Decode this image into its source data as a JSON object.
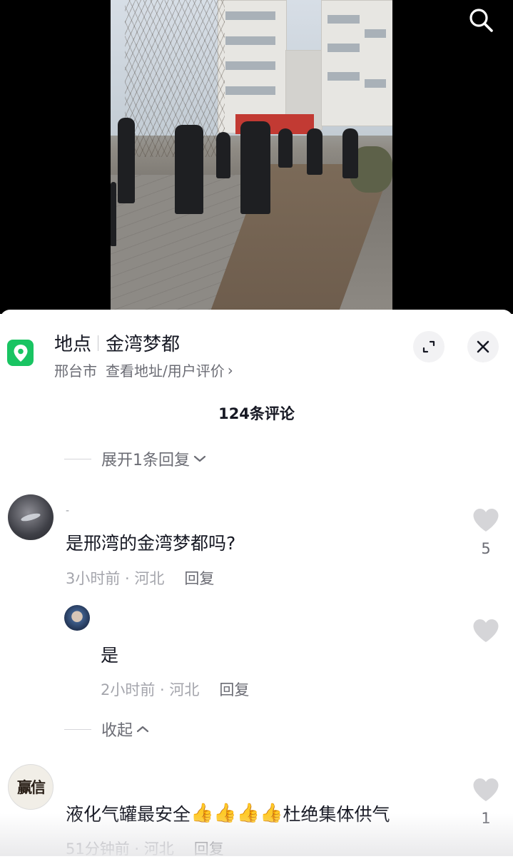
{
  "video": {
    "search_icon": "search-icon"
  },
  "location": {
    "label": "地点",
    "name": "金湾梦都",
    "city": "邢台市",
    "link": "查看地址/用户评价",
    "link_chevron": "›",
    "pin_color": "#19c462"
  },
  "comments_header": {
    "count_text": "124条评论"
  },
  "expand_replies": {
    "label": "展开1条回复",
    "icon": "chevron-down-icon"
  },
  "comments": [
    {
      "username": "-",
      "text": "是邢湾的金湾梦都吗?",
      "time": "3小时前 · 河北",
      "reply_label": "回复",
      "likes": "5",
      "replies": [
        {
          "text": "是",
          "time": "2小时前 · 河北",
          "reply_label": "回复"
        }
      ]
    },
    {
      "avatar_text": "赢信",
      "text_before": "液化气罐最安全",
      "emoji": "👍",
      "text_after": "杜绝集体供气",
      "time": "51分钟前 · 河北",
      "reply_label": "回复",
      "likes": "1"
    }
  ],
  "collapse": {
    "label": "收起",
    "icon": "chevron-up-icon"
  },
  "colors": {
    "text_primary": "#161823",
    "text_secondary": "#6b6c74",
    "like_gray": "#d5d5d8"
  }
}
